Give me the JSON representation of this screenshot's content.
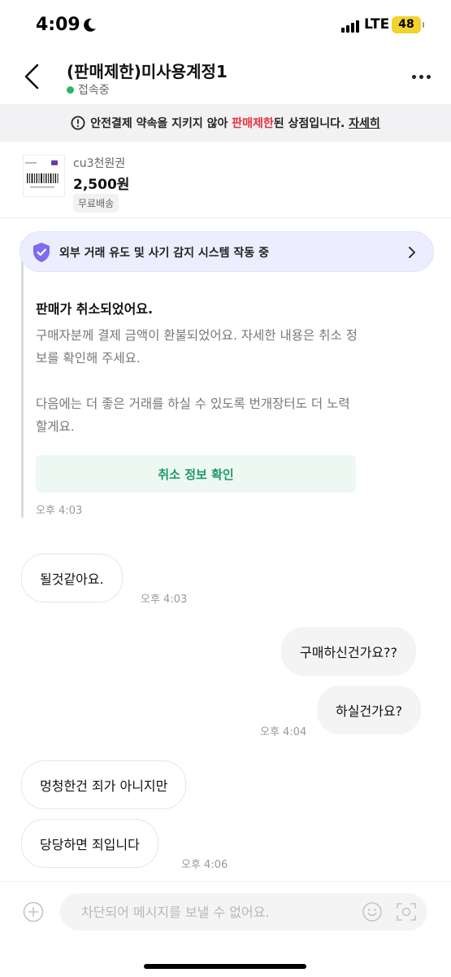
{
  "status_bar": {
    "time": "4:09",
    "network": "LTE",
    "battery": "48"
  },
  "header": {
    "title": "(판매제한)미사용계정1",
    "status": "접속중"
  },
  "warning": {
    "text_before": "안전결제 약속을 지키지 않아",
    "highlight": "판매제한",
    "text_after": "된 상점입니다.",
    "link": "자세히"
  },
  "product": {
    "name": "cu3천원권",
    "price": "2,500원",
    "shipping": "무료배송"
  },
  "fraud_bar": {
    "text": "외부 거래 유도 및 사기 감지 시스템 작동 중"
  },
  "system_message": {
    "title": "판매가 취소되었어요.",
    "body1": "구매자분께 결제 금액이 환불되었어요. 자세한 내용은 취소 정보를 확인해 주세요.",
    "body2": "다음에는 더 좋은 거래를 하실 수 있도록 번개장터도 더 노력할게요.",
    "button": "취소 정보 확인",
    "time": "오후 4:03"
  },
  "messages": [
    {
      "text": "될것같아요.",
      "direction": "in",
      "time": "오후 4:03"
    },
    {
      "text": "구매하신건가요??",
      "direction": "out",
      "time": ""
    },
    {
      "text": "하실건가요?",
      "direction": "out",
      "time": "오후 4:04"
    },
    {
      "text": "멍청한건 죄가 아니지만",
      "direction": "in",
      "time": ""
    },
    {
      "text": "당당하면 죄입니다",
      "direction": "in",
      "time": "오후 4:06"
    }
  ],
  "input": {
    "placeholder": "차단되어 메시지를 보낼 수 없어요."
  },
  "colors": {
    "accent_green": "#1e9a63",
    "warning_red": "#e8313d",
    "online_green": "#27b866",
    "battery_yellow": "#f2d22d"
  },
  "icons": [
    "back-arrow-icon",
    "more-icon",
    "alert-circle-icon",
    "shield-check-icon",
    "chevron-right-icon",
    "plus-circle-icon",
    "emoji-icon",
    "camera-icon",
    "moon-icon"
  ]
}
